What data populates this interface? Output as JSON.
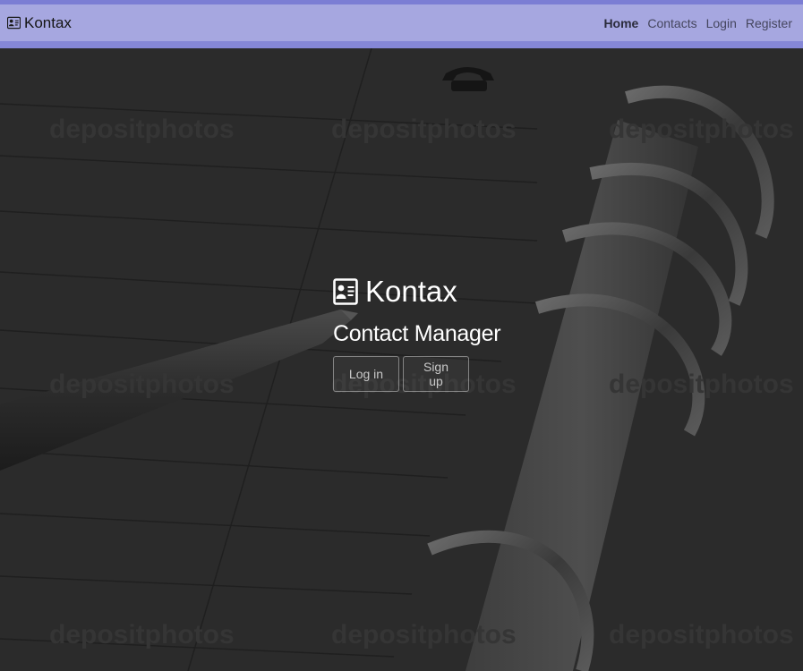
{
  "navbar": {
    "brand": "Kontax",
    "links": [
      "Home",
      "Contacts",
      "Login",
      "Register"
    ],
    "active": "Home"
  },
  "hero": {
    "title": "Kontax",
    "subtitle": "Contact Manager",
    "buttons": [
      "Log in",
      "Sign up"
    ]
  },
  "background": {
    "watermark": "depositphotos"
  },
  "colors": {
    "navbar_bg": "#a6a7e0",
    "navbar_border": "#8587d6",
    "hero_overlay": "#262626",
    "text": "#ffffff"
  }
}
